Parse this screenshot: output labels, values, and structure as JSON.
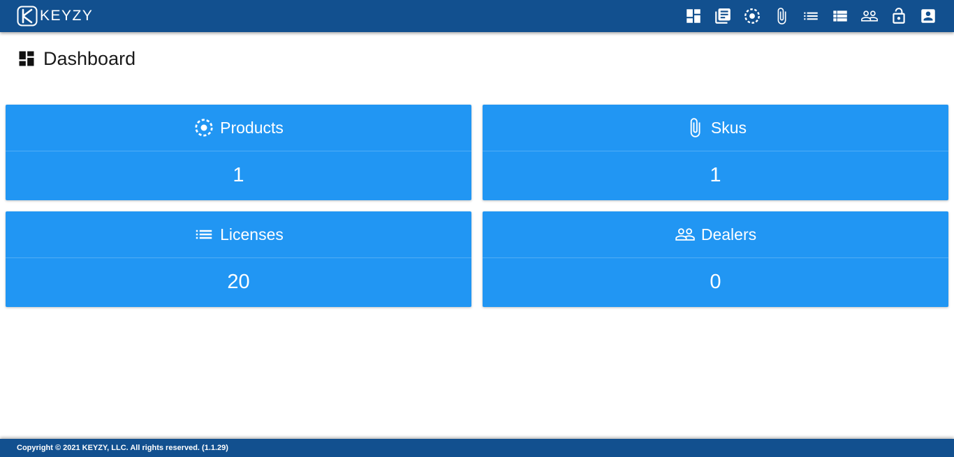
{
  "app": {
    "brand": "KEYZY"
  },
  "nav": {
    "icons": [
      "dashboard-icon",
      "library-books-icon",
      "products-icon",
      "attachment-icon",
      "list-icon",
      "view-list-icon",
      "people-icon",
      "lock-open-icon",
      "account-box-icon"
    ]
  },
  "page": {
    "title": "Dashboard",
    "icon": "dashboard-icon"
  },
  "cards": [
    {
      "label": "Products",
      "value": "1",
      "icon": "products-icon"
    },
    {
      "label": "Skus",
      "value": "1",
      "icon": "attachment-icon"
    },
    {
      "label": "Licenses",
      "value": "20",
      "icon": "list-icon"
    },
    {
      "label": "Dealers",
      "value": "0",
      "icon": "people-icon"
    }
  ],
  "footer": {
    "copyright": "Copyright © 2021 KEYZY, LLC. All rights reserved. (1.1.29)"
  },
  "colors": {
    "header": "#12508f",
    "card": "#2196f3",
    "text_on_dark": "#ffffff",
    "title_text": "#1a1a1a"
  }
}
